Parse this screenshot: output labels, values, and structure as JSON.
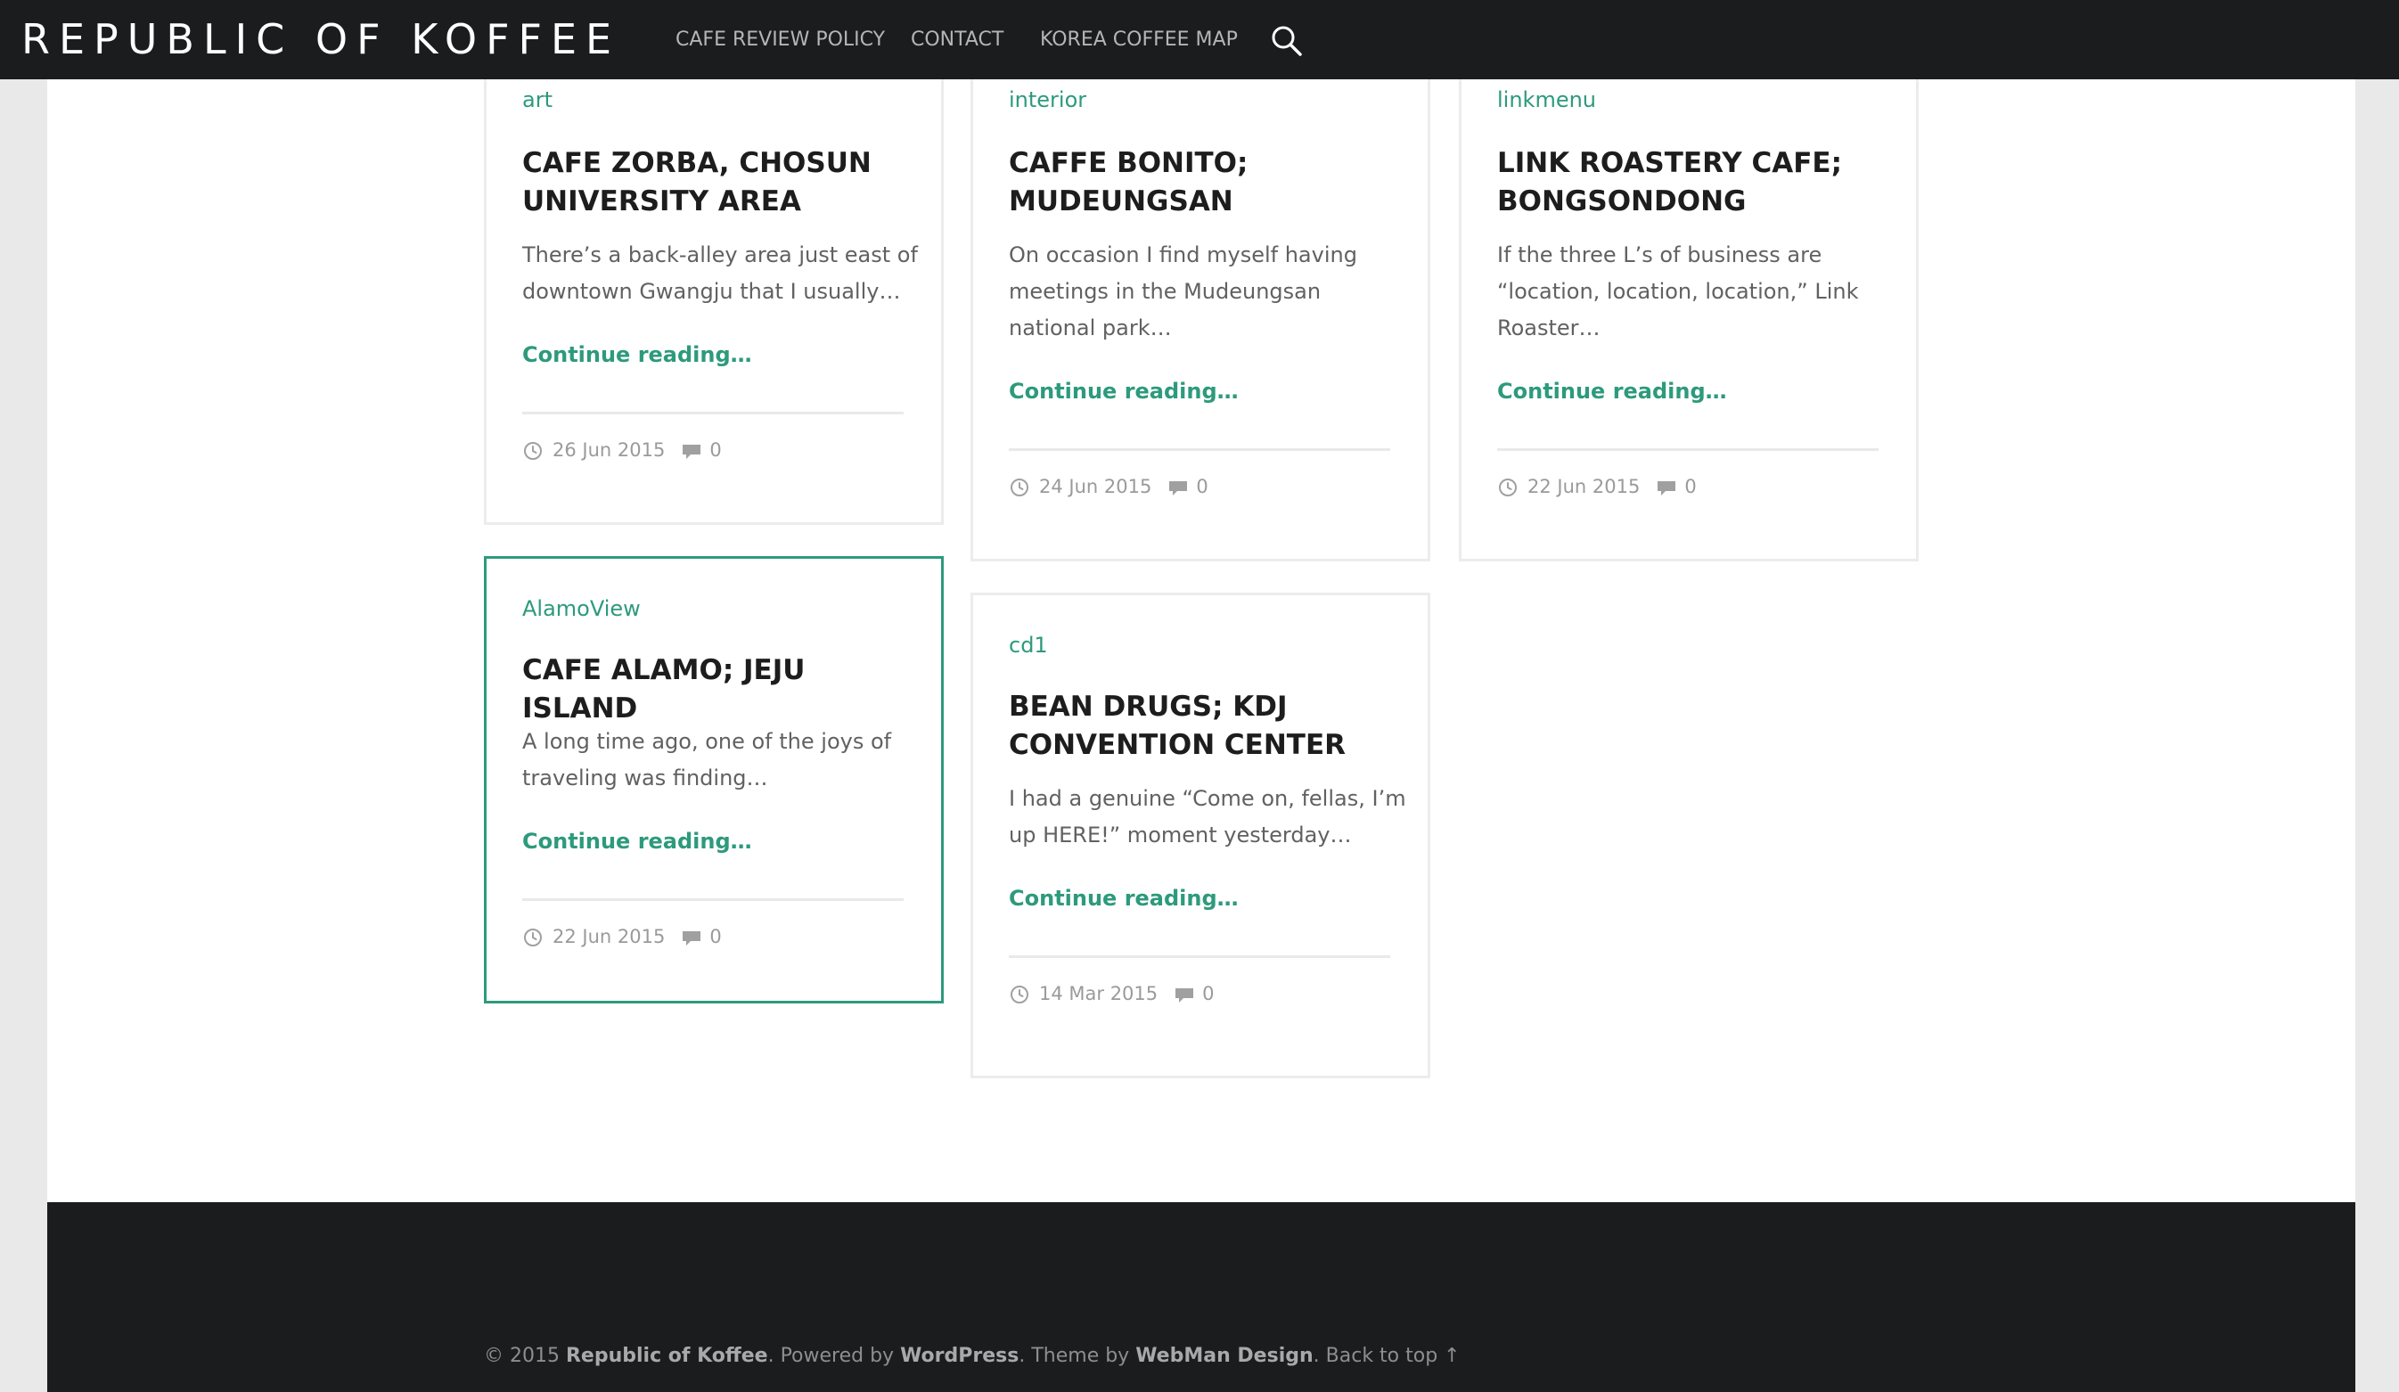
{
  "header": {
    "site_title": "REPUBLIC OF KOFFEE",
    "nav": [
      {
        "label": "CAFE REVIEW POLICY"
      },
      {
        "label": "CONTACT"
      },
      {
        "label": "KOREA COFFEE MAP"
      }
    ],
    "search_icon": "search-icon"
  },
  "posts": [
    {
      "category": "art",
      "title": "CAFE ZORBA, CHOSUN UNIVERSITY AREA",
      "excerpt": "There’s a back-alley area just east of downtown Gwangju that I usually…",
      "more": "Continue reading…",
      "date": "26 Jun 2015",
      "comments": "0"
    },
    {
      "category": "interior",
      "title": "CAFFE BONITO; MUDEUNGSAN",
      "excerpt": "On occasion I find myself having meetings in the Mudeungsan national park…",
      "more": "Continue reading…",
      "date": "24 Jun 2015",
      "comments": "0"
    },
    {
      "category": "linkmenu",
      "title": "LINK ROASTERY CAFE; BONGSONDONG",
      "excerpt": "If the three L’s of business are “location, location, location,” Link Roaster…",
      "more": "Continue reading…",
      "date": "22 Jun 2015",
      "comments": "0"
    },
    {
      "category": "AlamoView",
      "title": "CAFE ALAMO; JEJU ISLAND",
      "excerpt": "A long time ago, one of the joys of traveling was finding…",
      "more": "Continue reading…",
      "date": "22 Jun 2015",
      "comments": "0"
    },
    {
      "category": "cd1",
      "title": "BEAN DRUGS; KDJ CONVENTION CENTER",
      "excerpt": "I had a genuine “Come on, fellas, I’m up HERE!” moment yesterday…",
      "more": "Continue reading…",
      "date": "14 Mar 2015",
      "comments": "0"
    }
  ],
  "footer": {
    "copyright": "© 2015 ",
    "site_link": "Republic of Koffee",
    "powered": ". Powered by ",
    "wp_link": "WordPress",
    "theme": ". Theme by ",
    "theme_link": "WebMan Design",
    "sep": ". ",
    "back_to_top": "Back to top ↑"
  },
  "colors": {
    "accent": "#2d9a7c",
    "header_bg": "#1b1c1e",
    "footer_bg": "#1b1c1e",
    "page_bg": "#e9e9e9"
  }
}
